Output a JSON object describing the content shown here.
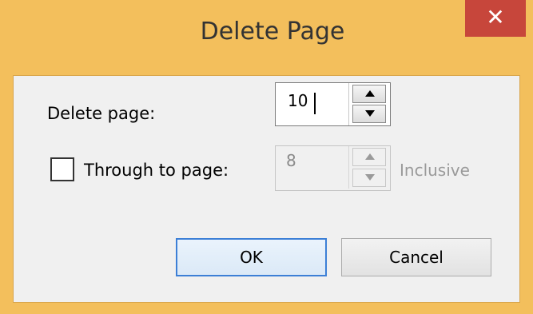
{
  "window": {
    "title": "Delete Page",
    "close_glyph": "✕"
  },
  "colors": {
    "titlebar": "#f3bf5c",
    "close_button": "#c7463b",
    "client_background": "#f0f0f0",
    "default_button_border": "#3c7fd6"
  },
  "delete_page": {
    "label": "Delete page:",
    "value": "10"
  },
  "through_page": {
    "checked": false,
    "label": "Through to page:",
    "value": "8",
    "enabled": false,
    "suffix": "Inclusive"
  },
  "buttons": {
    "ok": "OK",
    "cancel": "Cancel"
  }
}
